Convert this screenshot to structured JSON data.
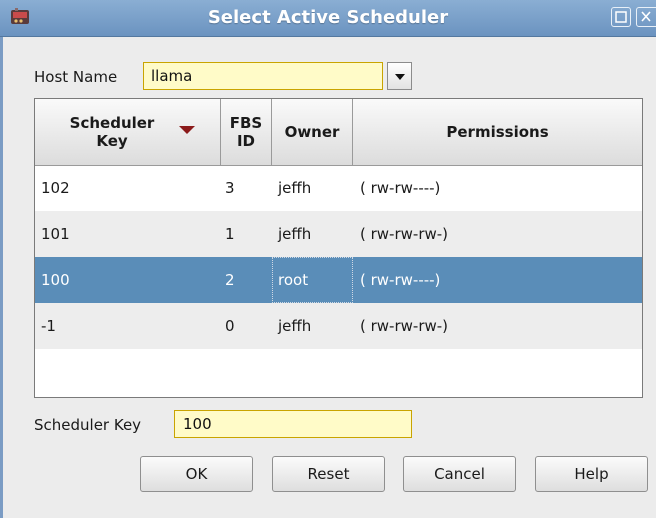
{
  "window": {
    "title": "Select Active Scheduler",
    "titlebar_color": "#6b93c0",
    "app_icon": "app-icon",
    "controls": [
      "maximize-icon",
      "close-icon"
    ]
  },
  "host": {
    "label": "Host Name",
    "value": "llama",
    "field_color": "#fffbc8"
  },
  "table": {
    "columns": [
      {
        "label": "Scheduler Key",
        "sorted": "descending"
      },
      {
        "label": "FBS ID"
      },
      {
        "label": "Owner"
      },
      {
        "label": "Permissions"
      }
    ],
    "header_key_line1": "Scheduler",
    "header_key_line2": "Key",
    "header_fbs_line1": "FBS",
    "header_fbs_line2": "ID",
    "header_owner": "Owner",
    "header_perm": "Permissions",
    "sort_arrow_color": "#8b1a1a",
    "selected_row_color": "#5a8db8",
    "rows": [
      {
        "key": "102",
        "fbs": "3",
        "owner": "jeffh",
        "perm": "( rw-rw----)"
      },
      {
        "key": "101",
        "fbs": "1",
        "owner": "jeffh",
        "perm": "( rw-rw-rw-)"
      },
      {
        "key": "100",
        "fbs": "2",
        "owner": "root",
        "perm": "( rw-rw----)"
      },
      {
        "key": "-1",
        "fbs": "0",
        "owner": "jeffh",
        "perm": "( rw-rw-rw-)"
      }
    ],
    "selected_index": 2
  },
  "scheduler_key": {
    "label": "Scheduler Key",
    "value": "100"
  },
  "buttons": {
    "ok": "OK",
    "reset": "Reset",
    "cancel": "Cancel",
    "help": "Help"
  }
}
